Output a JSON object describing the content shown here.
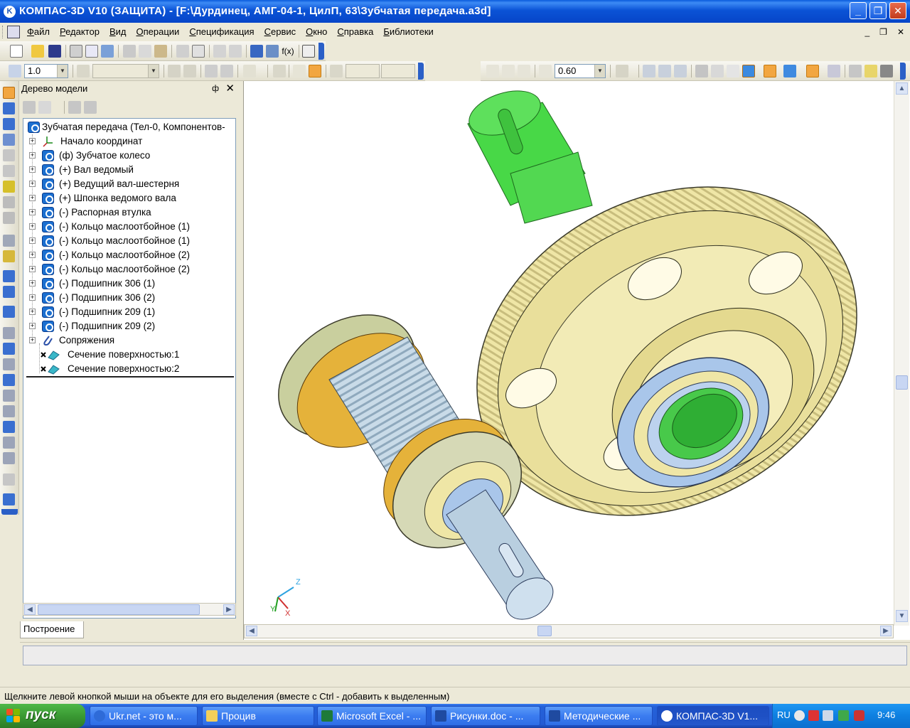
{
  "window": {
    "title": "КОМПАС-3D V10 (ЗАЩИТА) - [F:\\Дурдинец, АМГ-04-1, ЦилП, 63\\Зубчатая передача.a3d]",
    "app_icon_letter": "K"
  },
  "menu": {
    "items": [
      "Файл",
      "Редактор",
      "Вид",
      "Операции",
      "Спецификация",
      "Сервис",
      "Окно",
      "Справка",
      "Библиотеки"
    ]
  },
  "toolbar": {
    "step_value": "1.0",
    "zoom_value": "0.60",
    "fx_label": "f(x)"
  },
  "tree": {
    "panel_title": "Дерево модели",
    "pin_glyph": "ф",
    "close_glyph": "✕",
    "root_label": "Зубчатая передача (Тел-0, Компонентов-",
    "items": [
      {
        "label": "Начало координат",
        "icon": "axes-icon"
      },
      {
        "label": "(ф) Зубчатое колесо",
        "icon": "part-icon"
      },
      {
        "label": "(+) Вал ведомый",
        "icon": "part-icon"
      },
      {
        "label": "(+) Ведущий вал-шестерня",
        "icon": "part-icon"
      },
      {
        "label": "(+) Шпонка ведомого вала",
        "icon": "part-icon"
      },
      {
        "label": "(-) Распорная втулка",
        "icon": "part-icon"
      },
      {
        "label": "(-) Кольцо маслоотбойное (1)",
        "icon": "part-icon"
      },
      {
        "label": "(-) Кольцо маслоотбойное (1)",
        "icon": "part-icon"
      },
      {
        "label": "(-) Кольцо маслоотбойное (2)",
        "icon": "part-icon"
      },
      {
        "label": "(-) Кольцо маслоотбойное (2)",
        "icon": "part-icon"
      },
      {
        "label": "(-) Подшипник 306 (1)",
        "icon": "part-icon"
      },
      {
        "label": "(-) Подшипник 306 (2)",
        "icon": "part-icon"
      },
      {
        "label": "(-) Подшипник 209 (1)",
        "icon": "part-icon"
      },
      {
        "label": "(-) Подшипник 209 (2)",
        "icon": "part-icon"
      },
      {
        "label": "Сопряжения",
        "icon": "paperclip-icon"
      },
      {
        "label": "Сечение поверхностью:1",
        "icon": "section-icon"
      },
      {
        "label": "Сечение поверхностью:2",
        "icon": "section-icon"
      }
    ],
    "tab_label": "Построение"
  },
  "viewport": {
    "axis_labels": {
      "x": "X",
      "y": "Y",
      "z": "Z"
    },
    "colors": {
      "gear": "#efe6a6",
      "gear_dark": "#b7ac6c",
      "shaft_green": "#48d847",
      "pinion_blue": "#b9cfe0",
      "bearing_blue": "#a9c6ea",
      "collar_orange": "#e5b23a",
      "ring_grey": "#d6d9b6"
    }
  },
  "status": {
    "hint": "Щелкните левой кнопкой мыши на объекте для его выделения (вместе с Ctrl - добавить к выделенным)"
  },
  "taskbar": {
    "start_label": "пуск",
    "tasks": [
      {
        "label": "Ukr.net - это м...",
        "icon": "browser-icon"
      },
      {
        "label": "Процив",
        "icon": "folder-icon"
      },
      {
        "label": "Microsoft Excel - ...",
        "icon": "excel-icon"
      },
      {
        "label": "Рисунки.doc - ...",
        "icon": "word-icon"
      },
      {
        "label": "Методические ...",
        "icon": "word-icon"
      },
      {
        "label": "КОМПАС-3D V1...",
        "icon": "kompas-icon",
        "active": true
      }
    ],
    "tray_lang": "RU",
    "clock": "9:46"
  }
}
